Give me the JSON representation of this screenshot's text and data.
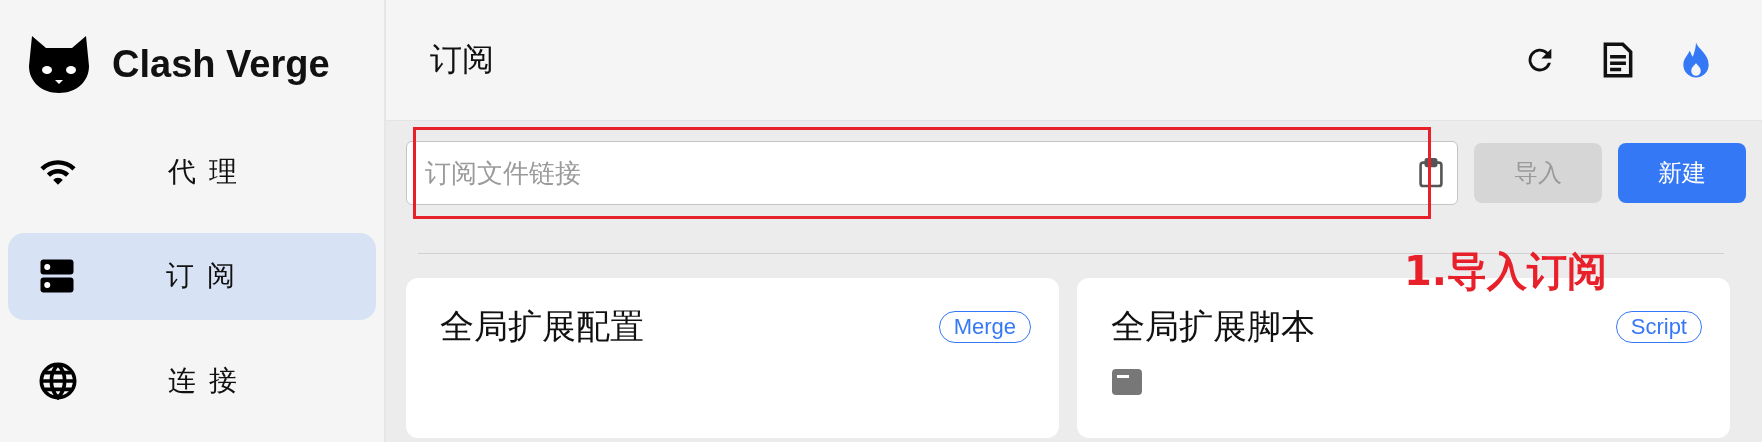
{
  "app": {
    "name": "Clash Verge"
  },
  "sidebar": {
    "items": [
      {
        "label": "代 理",
        "selected": false
      },
      {
        "label": "订 阅",
        "selected": true
      },
      {
        "label": "连 接",
        "selected": false
      }
    ]
  },
  "header": {
    "title": "订阅"
  },
  "import_bar": {
    "placeholder": "订阅文件链接",
    "buttons": [
      {
        "label": "导入",
        "disabled": true
      },
      {
        "label": "新建",
        "disabled": false
      }
    ]
  },
  "cards": [
    {
      "title": "全局扩展配置",
      "tag": "Merge",
      "icon": false
    },
    {
      "title": "全局扩展脚本",
      "tag": "Script",
      "icon": true
    }
  ],
  "annotation": {
    "text": "1.导入订阅"
  }
}
